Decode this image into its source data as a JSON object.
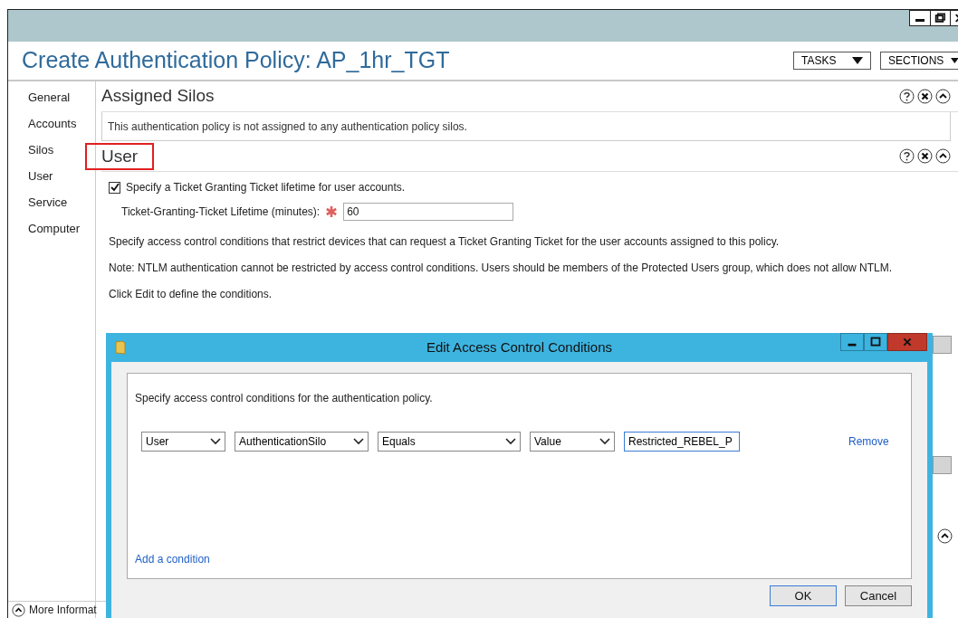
{
  "window": {
    "title": "Create Authentication Policy: AP_1hr_TGT",
    "buttons": [
      "TASKS",
      "SECTIONS"
    ]
  },
  "sidebar": {
    "items": [
      {
        "label": "General",
        "selected": false
      },
      {
        "label": "Accounts",
        "selected": false
      },
      {
        "label": "Silos",
        "selected": false
      },
      {
        "label": "User",
        "selected": false
      },
      {
        "label": "Service",
        "selected": false
      },
      {
        "label": "Computer",
        "selected": false
      }
    ]
  },
  "sections": [
    {
      "title": "Assigned Silos",
      "highlighted": false,
      "text": "This authentication policy is not assigned to any authentication policy silos."
    },
    {
      "title": "User",
      "highlighted": true
    }
  ],
  "user": {
    "checkbox": {
      "label": "Specify a Ticket Granting Ticket lifetime for user accounts.",
      "checked": true
    },
    "lifetime_label": "Ticket-Granting-Ticket Lifetime (minutes):",
    "lifetime_value": "60",
    "paragraphs": [
      "Specify access control conditions that restrict devices that can request a Ticket Granting Ticket for the user accounts assigned to this policy.",
      "Note: NTLM authentication cannot be restricted by access control conditions. Users should be members of the Protected Users group, which does not allow NTLM.",
      "Click Edit to define the conditions."
    ]
  },
  "footer": {
    "label": "More Informat"
  },
  "dialog": {
    "title": "Edit Access Control Conditions",
    "intro": "Specify access control conditions for the authentication policy.",
    "condition": {
      "dropdowns": [
        "User",
        "AuthenticationSilo",
        "Equals",
        "Value"
      ],
      "value": "Restricted_REBEL_P",
      "remove": "Remove"
    },
    "add": "Add a condition",
    "buttons": [
      "OK",
      "Cancel"
    ]
  }
}
